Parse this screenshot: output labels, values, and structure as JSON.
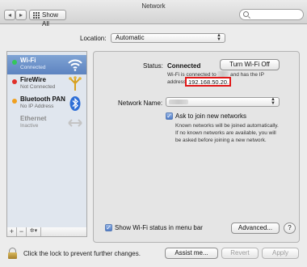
{
  "window": {
    "title": "Network"
  },
  "toolbar": {
    "show_all_label": "Show All",
    "back_icon": "chevron-left-icon",
    "forward_icon": "chevron-right-icon",
    "search_placeholder": ""
  },
  "location": {
    "label": "Location:",
    "value": "Automatic"
  },
  "services": [
    {
      "name": "Wi-Fi",
      "status": "Connected",
      "dot_color": "#34c759",
      "icon": "wifi-icon",
      "selected": true
    },
    {
      "name": "FireWire",
      "status": "Not Connected",
      "dot_color": "#e0302a",
      "icon": "firewire-icon",
      "selected": false
    },
    {
      "name": "Bluetooth PAN",
      "status": "No IP Address",
      "dot_color": "#f0a020",
      "icon": "bluetooth-icon",
      "selected": false
    },
    {
      "name": "Ethernet",
      "status": "Inactive",
      "dot_color": "",
      "icon": "ethernet-icon",
      "selected": false
    }
  ],
  "sidebar_controls": {
    "add": "+",
    "remove": "−",
    "action": "✲▾"
  },
  "detail": {
    "status_label": "Status:",
    "status_value": "Connected",
    "turn_off_button": "Turn Wi-Fi Off",
    "status_desc_prefix": "Wi-Fi is connected to",
    "status_desc_suffix": "and has the IP",
    "status_desc_line2": "address",
    "ip_address": "192.168.50.20.",
    "network_name_label": "Network Name:",
    "ask_to_join_label": "Ask to join new networks",
    "ask_to_join_checked": true,
    "ask_to_join_desc": [
      "Known networks will be joined automatically.",
      "If no known networks are available, you will",
      "be asked before joining a new network."
    ],
    "show_status_label": "Show Wi-Fi status in menu bar",
    "show_status_checked": true,
    "advanced_button": "Advanced...",
    "help_button": "?"
  },
  "footer": {
    "lock_text": "Click the lock to prevent further changes.",
    "assist_button": "Assist me...",
    "revert_button": "Revert",
    "apply_button": "Apply"
  },
  "colors": {
    "accent": "#5d83c0",
    "highlight_box": "#e01818"
  }
}
